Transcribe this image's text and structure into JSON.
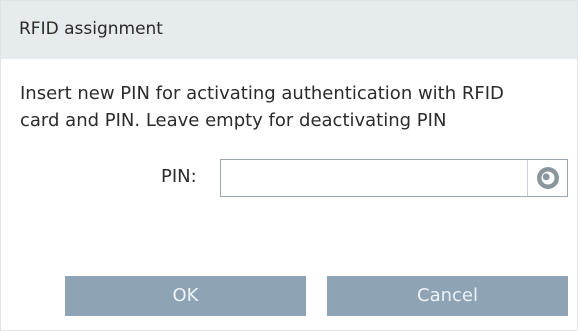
{
  "dialog": {
    "title": "RFID assignment",
    "message_line1": "Insert new PIN for activating authentication with RFID",
    "message_line2": "card and PIN. Leave empty for deactivating PIN"
  },
  "pin": {
    "label": "PIN:",
    "value": "",
    "toggle_icon": "eye-icon"
  },
  "buttons": {
    "ok_label": "OK",
    "cancel_label": "Cancel"
  },
  "colors": {
    "title_bar": "#e6ebee",
    "button_bg": "#8ea4b4",
    "button_text": "#eef2f5",
    "eye_icon": "#8a969e"
  }
}
